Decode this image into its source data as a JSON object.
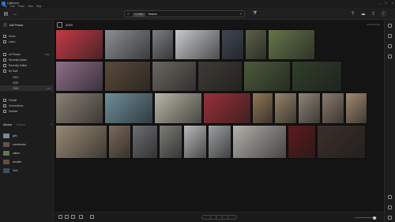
{
  "app": {
    "title": "Lightroom"
  },
  "menu": [
    "File",
    "Edit",
    "Photo",
    "View",
    "Help"
  ],
  "search": {
    "chip": "In 2019",
    "value": "flowers"
  },
  "sidebar": {
    "account": "Adil Photos",
    "items": [
      {
        "label": "Home",
        "count": ""
      },
      {
        "label": "Learn",
        "count": ""
      },
      {
        "label": "All Photos",
        "count": "7,892"
      },
      {
        "label": "Recently Added",
        "count": ""
      },
      {
        "label": "Recently Edited",
        "count": ""
      },
      {
        "label": "By Date",
        "count": ""
      }
    ],
    "years": [
      {
        "label": "2021",
        "count": ""
      },
      {
        "label": "2020",
        "count": ""
      },
      {
        "label": "2019",
        "count": "48"
      }
    ],
    "more": [
      {
        "label": "People",
        "count": ""
      },
      {
        "label": "Connections",
        "count": ""
      },
      {
        "label": "Deleted",
        "count": ""
      }
    ]
  },
  "albums": {
    "label": "Albums",
    "ghost": "Shared",
    "items": [
      {
        "label": "girls",
        "count": "",
        "color": "#7a8a99"
      },
      {
        "label": "construction",
        "count": "",
        "color": "#5e5550"
      },
      {
        "label": "nature",
        "count": "",
        "color": "#5d7a4a"
      },
      {
        "label": "wooden",
        "count": "",
        "color": "#6a4c3a"
      },
      {
        "label": "Tech",
        "count": "",
        "color": "#3f4d5f"
      }
    ]
  },
  "main": {
    "title": "2019",
    "count": "2019 photos"
  },
  "pager": [
    "‹",
    "1",
    "2",
    "3",
    "4",
    "›"
  ],
  "photos": [
    {
      "color": "#c43b45"
    },
    {
      "color": "#8b8f93"
    },
    {
      "color": "#7d7f82"
    },
    {
      "color": "#c7c9cc"
    },
    {
      "color": "#3e4753"
    },
    {
      "color": "#5c6149"
    },
    {
      "color": "#64754a"
    },
    {
      "color": "#8f6e8a"
    },
    {
      "color": "#5a4a3a"
    },
    {
      "color": "#6b6660"
    },
    {
      "color": "#3d3a34"
    },
    {
      "color": "#4a5a3a"
    },
    {
      "color": "#2f3e2a"
    },
    {
      "color": "#8c8276"
    },
    {
      "color": "#6e8e9a"
    },
    {
      "color": "#b8b6a6"
    },
    {
      "color": "#9a3038"
    },
    {
      "color": "#8e7756"
    },
    {
      "color": "#95846a"
    },
    {
      "color": "#8f8577"
    },
    {
      "color": "#8a7b6d"
    },
    {
      "color": "#a08a70"
    },
    {
      "color": "#9a8974"
    },
    {
      "color": "#7a6a5a"
    },
    {
      "color": "#6d6e70"
    },
    {
      "color": "#7b7c75"
    },
    {
      "color": "#b8b9ba"
    },
    {
      "color": "#9d9fa1"
    },
    {
      "color": "#b2b0aa"
    },
    {
      "color": "#5c1a1c"
    },
    {
      "color": "#3b2f2a"
    },
    {
      "color": "#46403a"
    }
  ]
}
